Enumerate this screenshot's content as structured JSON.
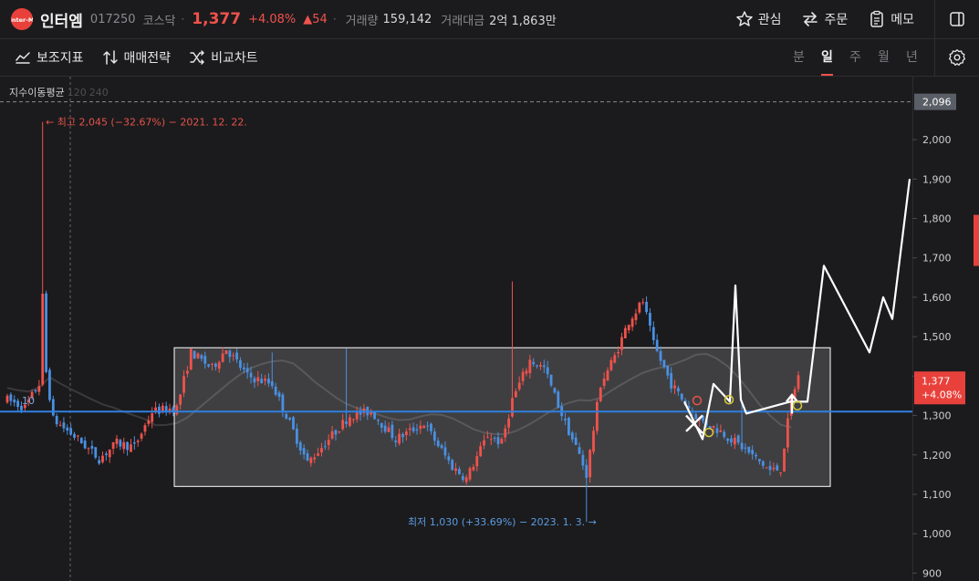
{
  "header": {
    "name": "인터엠",
    "code": "017250",
    "market": "코스닥",
    "price": "1,377",
    "change_pct": "+4.08%",
    "change_abs": "▲54",
    "volume_label": "거래량",
    "volume": "159,142",
    "amount_label": "거래대금",
    "amount": "2억 1,863만",
    "logo_text": "inter-M"
  },
  "actions": {
    "watch": "관심",
    "order": "주문",
    "memo": "메모"
  },
  "toolbar": {
    "indicators": "보조지표",
    "strategy": "매매전략",
    "compare": "비교차트"
  },
  "periods": [
    "분",
    "일",
    "주",
    "월",
    "년"
  ],
  "active_period": "일",
  "ma_label": {
    "title": "지수이동평균",
    "p1": "120",
    "p2": "240"
  },
  "colors": {
    "up": "#f0524c",
    "down": "#4a90e2",
    "hline": "#2f7fe0",
    "box": "#ffffff"
  },
  "chart_data": {
    "type": "candlestick",
    "ylim": [
      880,
      2160
    ],
    "y_ticks": [
      900,
      1000,
      1100,
      1200,
      1300,
      1400,
      1500,
      1600,
      1700,
      1800,
      1900,
      2000
    ],
    "y_tick_labels": [
      "900",
      "1,000",
      "1,100",
      "1,200",
      "1,300",
      "1,400",
      "1,500",
      "1,600",
      "1,700",
      "1,800",
      "1,900",
      "2,000"
    ],
    "dashed_level": {
      "value": 2096,
      "label": "2,096"
    },
    "current_price": {
      "value": 1377,
      "label": "1,377",
      "change": "+4.08%"
    },
    "horizontal_line": 1310,
    "left_edge_label": "10",
    "high_annotation": {
      "price": 2045,
      "text": "← 최고 2,045 (−32.67%) − 2021. 12. 22."
    },
    "low_annotation": {
      "price": 1030,
      "text": "최저 1,030 (+33.69%) − 2023. 1. 3. →"
    },
    "range_box": {
      "top": 1472,
      "bottom": 1120
    },
    "projection_path": [
      [
        1325,
        1335
      ],
      [
        1480,
        1335
      ],
      [
        1565,
        1295
      ],
      [
        1655,
        1305
      ],
      [
        1635,
        1245
      ],
      [
        1615,
        1305
      ],
      [
        1645,
        1265
      ],
      [
        1570,
        1380
      ],
      [
        1640,
        1535
      ],
      [
        1480,
        1610
      ],
      [
        1460,
        1700
      ],
      [
        1555,
        1900
      ]
    ]
  }
}
